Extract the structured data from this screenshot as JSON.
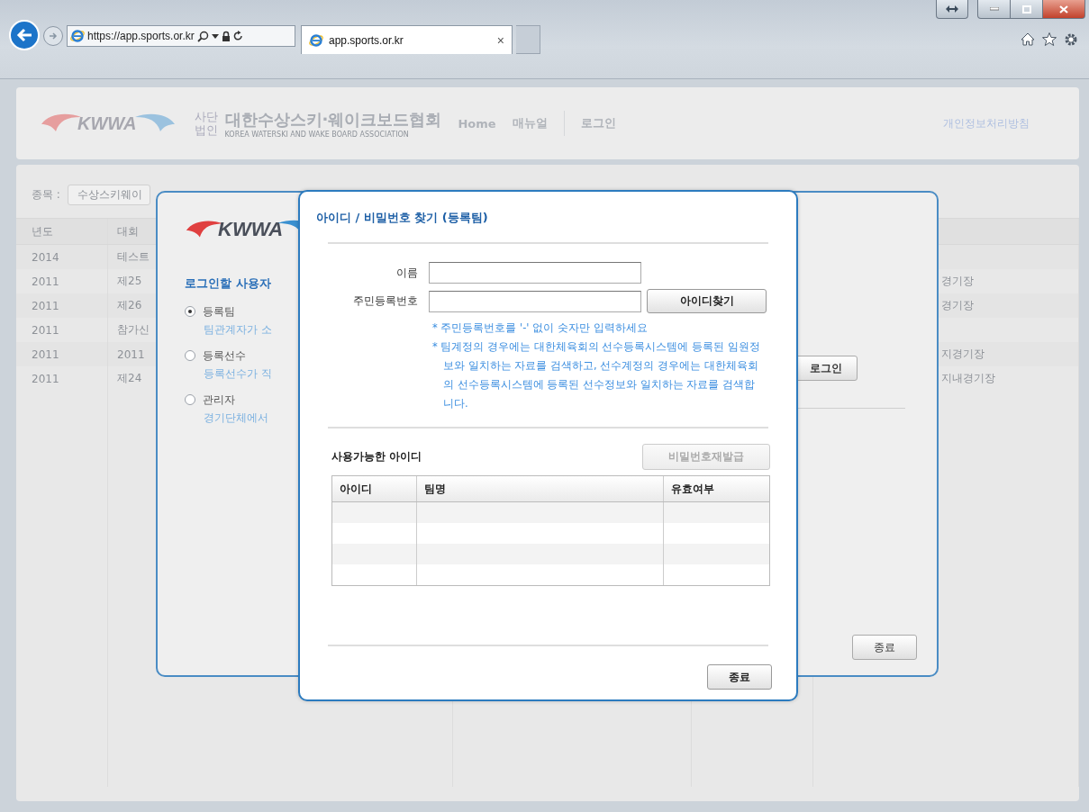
{
  "browser": {
    "address": "https://app.sports.or.kr",
    "tab_title": "app.sports.or.kr",
    "tab_close": "×"
  },
  "site_header": {
    "logo_text": "KWWA",
    "org_type_top": "사단",
    "org_type_bottom": "법인",
    "org_name": "대한수상스키·웨이크보드협회",
    "org_name_en": "KOREA WATERSKI AND WAKE BOARD ASSOCIATION",
    "nav": [
      "Home",
      "매뉴얼",
      "로그인"
    ],
    "privacy_link": "개인정보처리방침"
  },
  "competition_list": {
    "filter_label": "종목 :",
    "filter_value": "수상스키웨이",
    "columns": [
      "년도",
      "대회"
    ],
    "rows": [
      {
        "year": "2014",
        "name": "테스트"
      },
      {
        "year": "2011",
        "name": "제25",
        "venue": "경기장"
      },
      {
        "year": "2011",
        "name": "제26",
        "venue": "경기장"
      },
      {
        "year": "2011",
        "name": "참가신"
      },
      {
        "year": "2011",
        "name": "2011",
        "venue": "지경기장"
      },
      {
        "year": "2011",
        "name": "제24",
        "venue": "지내경기장"
      }
    ]
  },
  "login_dialog": {
    "logo_text": "KWWA",
    "prompt": "로그인할 사용자",
    "options": [
      {
        "label": "등록팀",
        "description": "팀관계자가 소",
        "selected": true
      },
      {
        "label": "등록선수",
        "description": "등록선수가 직",
        "selected": false
      },
      {
        "label": "관리자",
        "description": "경기단체에서",
        "selected": false
      }
    ],
    "login_button": "로그인",
    "close_button": "종료"
  },
  "find_dialog": {
    "title": "아이디 / 비밀번호 찾기 (등록팀)",
    "fields": [
      {
        "label": "이름"
      },
      {
        "label": "주민등록번호"
      }
    ],
    "find_button": "아이디찾기",
    "notes": [
      "* 주민등록번호를 '-' 없이 숫자만 입력하세요",
      "* 팀계정의 경우에는 대한체육회의 선수등록시스템에 등록된 임원정보와 일치하는 자료를 검색하고, 선수계정의 경우에는 대한체육회의 선수등록시스템에 등록된 선수정보와 일치하는 자료를 검색합니다."
    ],
    "result_title": "사용가능한 아이디",
    "reissue_button": {
      "label": "비밀번호재발급",
      "disabled": true
    },
    "columns": [
      "아이디",
      "팀명",
      "유효여부"
    ],
    "close_button": "종료"
  }
}
